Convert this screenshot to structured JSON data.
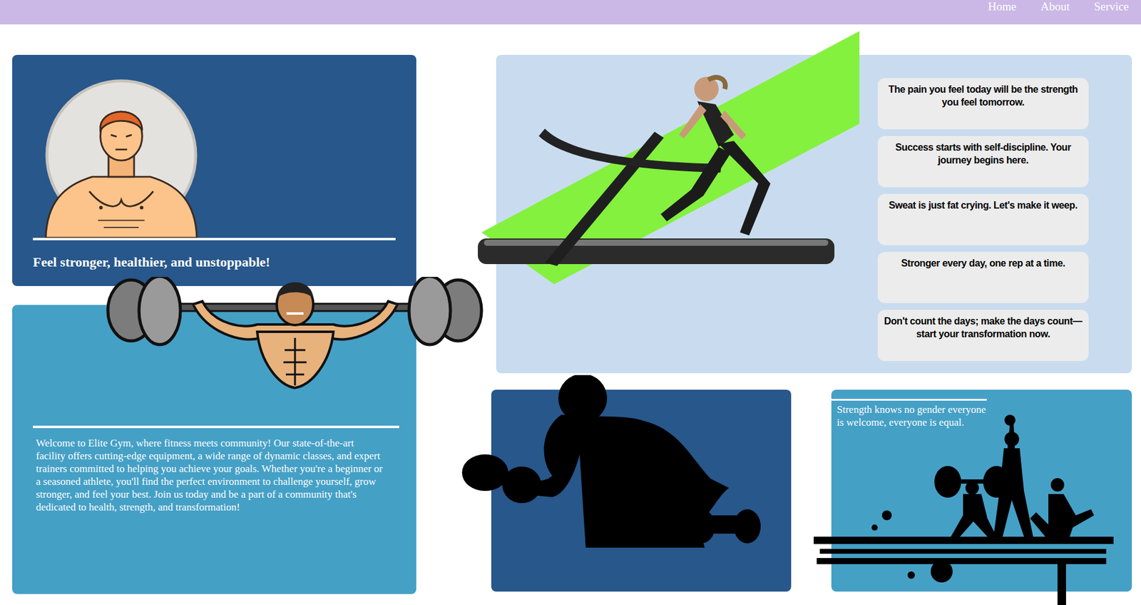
{
  "nav": {
    "links": [
      {
        "label": "Home"
      },
      {
        "label": "About"
      },
      {
        "label": "Service"
      }
    ]
  },
  "hero": {
    "tagline": "Feel stronger, healthier, and unstoppable!"
  },
  "welcome": {
    "text": "Welcome to Elite Gym, where fitness meets community! Our state-of-the-art facility offers cutting-edge equipment, a wide range of dynamic classes, and expert trainers committed to helping you achieve your goals. Whether you're a beginner or a seasoned athlete, you'll find the perfect environment to challenge yourself, grow stronger, and feel your best. Join us today and be a part of a community that's dedicated to health, strength, and transformation!"
  },
  "quotes": [
    {
      "text": "The pain you feel today will be the strength you feel tomorrow."
    },
    {
      "text": "Success starts with self-discipline. Your journey begins here."
    },
    {
      "text": "Sweat is just fat crying. Let's make it weep."
    },
    {
      "text": "Stronger every day, one rep at a time."
    },
    {
      "text": "Don't count the days; make the days count—start your transformation now."
    }
  ],
  "equality": {
    "text": "Strength knows no gender everyone is welcome, everyone is equal."
  }
}
